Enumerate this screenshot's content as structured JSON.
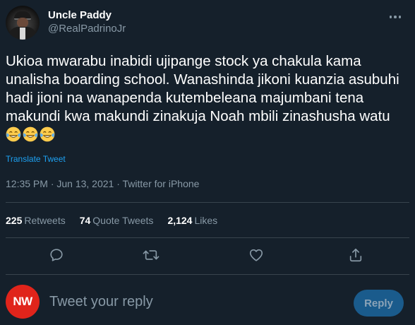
{
  "author": {
    "display_name": "Uncle Paddy",
    "handle": "@RealPadrinoJr"
  },
  "tweet": {
    "text": "Ukioa mwarabu inabidi ujipange stock ya chakula kama unalisha boarding school. Wanashinda jikoni kuanzia asubuhi hadi jioni na wanapenda kutembeleana majumbani tena makundi kwa makundi zinakuja Noah mbili zinashusha watu",
    "emojis": [
      "😂",
      "😂",
      "😂"
    ],
    "translate_label": "Translate Tweet",
    "meta": "12:35 PM · Jun 13, 2021 · Twitter for iPhone"
  },
  "stats": {
    "retweets_count": "225",
    "retweets_label": "Retweets",
    "quotes_count": "74",
    "quotes_label": "Quote Tweets",
    "likes_count": "2,124",
    "likes_label": "Likes"
  },
  "actions": {
    "icons": [
      "reply-icon",
      "retweet-icon",
      "like-icon",
      "share-icon"
    ]
  },
  "reply_box": {
    "avatar_text": "NW",
    "placeholder": "Tweet your reply",
    "button_label": "Reply"
  },
  "colors": {
    "background": "#15202b",
    "text_primary": "#ffffff",
    "text_secondary": "#8899a6",
    "link": "#1da1f2",
    "divider": "#38444d",
    "reply_button_bg": "#1a5b8c",
    "avatar_nw": "#e0241b"
  }
}
